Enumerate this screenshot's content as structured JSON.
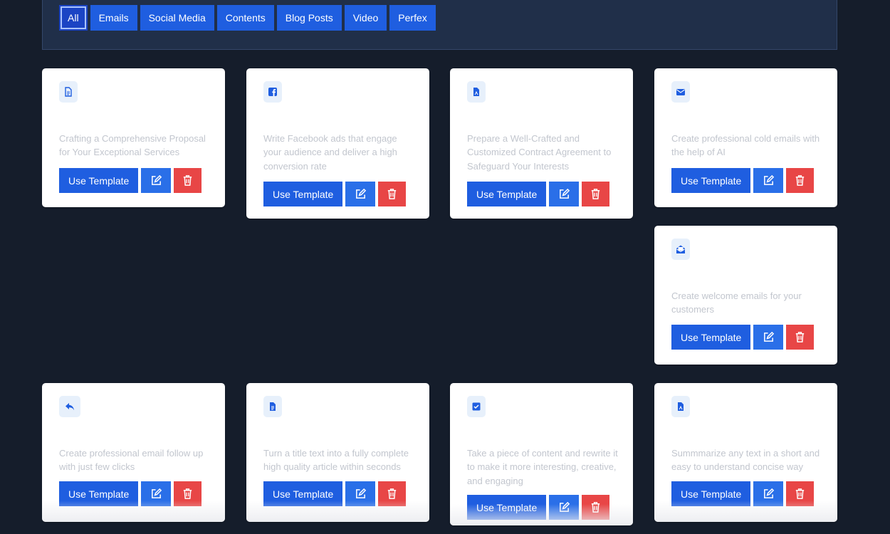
{
  "filters": [
    "All",
    "Emails",
    "Social Media",
    "Contents",
    "Blog Posts",
    "Video",
    "Perfex"
  ],
  "active_filter": "All",
  "use_template_label": "Use Template",
  "colors": {
    "primary": "#1f5ee0",
    "edit": "#2a6fe8",
    "delete": "#e84646",
    "icon_bg": "#e7f0fb"
  },
  "cards": [
    {
      "icon": "file-text-icon",
      "description": "Crafting a Comprehensive Proposal for Your Exceptional Services"
    },
    {
      "icon": "facebook-icon",
      "description": "Write Facebook ads that engage your audience and deliver a high conversion rate"
    },
    {
      "icon": "file-contract-icon",
      "description": "Prepare a Well-Crafted and Customized Contract Agreement to Safeguard Your Interests"
    },
    {
      "icon": "envelope-icon",
      "description": "Create professional cold emails with the help of AI"
    },
    {
      "icon": "envelope-open-icon",
      "description": "Create welcome emails for your customers"
    },
    {
      "icon": "reply-icon",
      "description": "Create professional email follow up with just few clicks"
    },
    {
      "icon": "file-article-icon",
      "description": "Turn a title text into a fully complete high quality article within seconds"
    },
    {
      "icon": "check-square-icon",
      "description": "Take a piece of content and rewrite it to make it more interesting, creative, and engaging"
    },
    {
      "icon": "file-summary-icon",
      "description": "Summmarize any text in a short and easy to understand concise way"
    }
  ]
}
